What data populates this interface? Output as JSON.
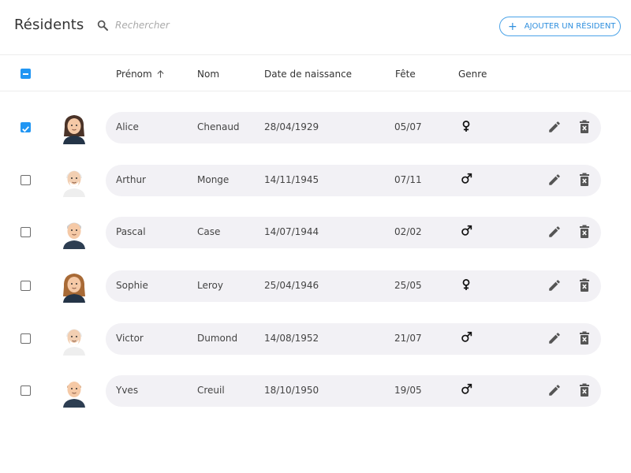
{
  "header": {
    "title": "Résidents",
    "search_placeholder": "Rechercher",
    "add_button_label": "AJOUTER UN RÉSIDENT"
  },
  "columns": {
    "first_name": "Prénom",
    "last_name": "Nom",
    "birth_date": "Date de naissance",
    "name_day": "Fête",
    "gender": "Genre"
  },
  "select_all_state": "indeterminate",
  "rows": [
    {
      "first_name": "Alice",
      "last_name": "Chenaud",
      "birth_date": "28/04/1929",
      "name_day": "05/07",
      "gender": "female",
      "selected": true
    },
    {
      "first_name": "Arthur",
      "last_name": "Monge",
      "birth_date": "14/11/1945",
      "name_day": "07/11",
      "gender": "male",
      "selected": false
    },
    {
      "first_name": "Pascal",
      "last_name": "Case",
      "birth_date": "14/07/1944",
      "name_day": "02/02",
      "gender": "male",
      "selected": false
    },
    {
      "first_name": "Sophie",
      "last_name": "Leroy",
      "birth_date": "25/04/1946",
      "name_day": "25/05",
      "gender": "female",
      "selected": false
    },
    {
      "first_name": "Victor",
      "last_name": "Dumond",
      "birth_date": "14/08/1952",
      "name_day": "21/07",
      "gender": "male",
      "selected": false
    },
    {
      "first_name": "Yves",
      "last_name": "Creuil",
      "birth_date": "18/10/1950",
      "name_day": "19/05",
      "gender": "male",
      "selected": false
    }
  ],
  "colors": {
    "accent": "#2196f3",
    "button_text": "#2f8fde",
    "row_background": "#f2f1f5",
    "icon": "#555555"
  }
}
